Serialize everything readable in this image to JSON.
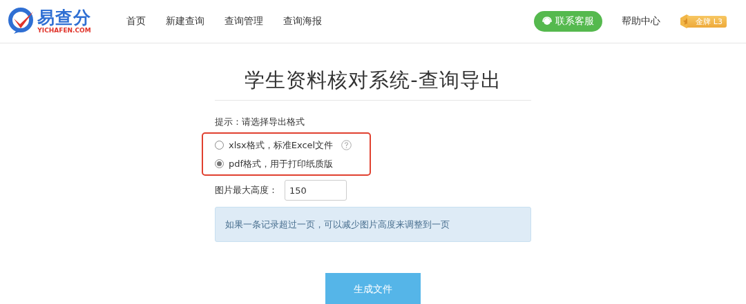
{
  "header": {
    "logo": {
      "mark": "易查分",
      "domain": "YICHAFEN.COM"
    },
    "nav": [
      {
        "label": "首页"
      },
      {
        "label": "新建查询"
      },
      {
        "label": "查询管理"
      },
      {
        "label": "查询海报"
      }
    ],
    "service_button": "联系客服",
    "help_link": "帮助中心",
    "level_badge": "金牌 L3"
  },
  "page": {
    "title": "学生资料核对系统-查询导出",
    "hint": "提示：请选择导出格式",
    "formats": [
      {
        "label": "xlsx格式，标准Excel文件",
        "selected": false,
        "help": true
      },
      {
        "label": "pdf格式，用于打印纸质版",
        "selected": true,
        "help": false
      }
    ],
    "max_height": {
      "label": "图片最大高度：",
      "value": "150"
    },
    "notice": "如果一条记录超过一页，可以减少图片高度来调整到一页",
    "submit": "生成文件"
  }
}
